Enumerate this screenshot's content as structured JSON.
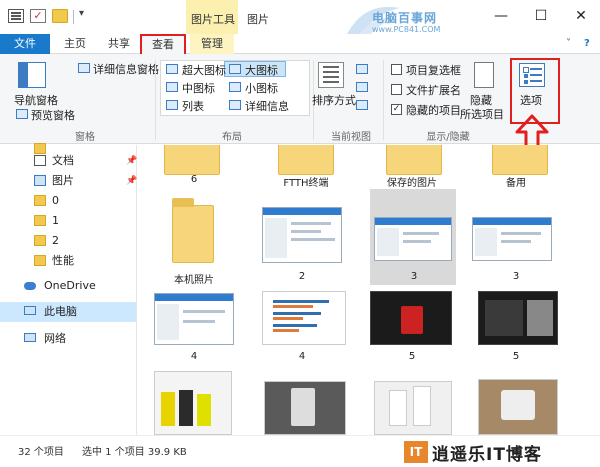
{
  "titlebar": {
    "tools_label": "图片工具",
    "window_title": "图片",
    "min_icon": "—",
    "max_icon": "☐",
    "close_icon": "✕",
    "watermark_title": "电脑百事网",
    "watermark_url": "www.PC841.COM"
  },
  "tabs": {
    "file": "文件",
    "home": "主页",
    "share": "共享",
    "view": "查看",
    "manage": "管理",
    "chevron": "˅",
    "help": "?"
  },
  "ribbon": {
    "pane_group": {
      "nav_pane": "导航窗格",
      "preview_pane": "预览窗格",
      "details_pane": "详细信息窗格",
      "label": "窗格"
    },
    "layout_group": {
      "extra_large": "超大图标",
      "large": "大图标",
      "medium": "中图标",
      "small": "小图标",
      "list": "列表",
      "details": "详细信息",
      "label": "布局"
    },
    "view_group": {
      "sort": "排序方式",
      "label": "当前视图"
    },
    "showhide_group": {
      "item_checkboxes": "项目复选框",
      "file_ext": "文件扩展名",
      "hidden_items": "隐藏的项目",
      "hide": "隐藏",
      "selected_items": "所选项目",
      "label": "显示/隐藏"
    },
    "options": "选项"
  },
  "nav": {
    "items": [
      {
        "label": "文档",
        "icon": "document-icon",
        "pinned": true
      },
      {
        "label": "图片",
        "icon": "pictures-icon",
        "pinned": true
      },
      {
        "label": "0",
        "icon": "folder-icon"
      },
      {
        "label": "1",
        "icon": "folder-icon"
      },
      {
        "label": "2",
        "icon": "folder-icon"
      },
      {
        "label": "性能",
        "icon": "folder-icon"
      },
      {
        "label": "OneDrive",
        "icon": "onedrive-icon"
      },
      {
        "label": "此电脑",
        "icon": "this-pc-icon"
      },
      {
        "label": "网络",
        "icon": "network-icon"
      }
    ],
    "pin_glyph": "📌"
  },
  "content": {
    "row0": [
      "6",
      "FTTH终端",
      "保存的图片",
      "备用"
    ],
    "row1": [
      "本机照片",
      "2",
      "3",
      "3"
    ],
    "row2": [
      "4",
      "4",
      "5",
      "5"
    ]
  },
  "status": {
    "count": "32 个项目",
    "selection": "选中 1 个项目  39.9 KB"
  },
  "brand": {
    "mark": "IT",
    "text": "逍遥乐IT博客"
  },
  "colors": {
    "file_tab": "#1979ca",
    "highlight_red": "#e02020",
    "tools_yellow": "#fcf0b0",
    "selection_blue": "#cce8ff"
  }
}
